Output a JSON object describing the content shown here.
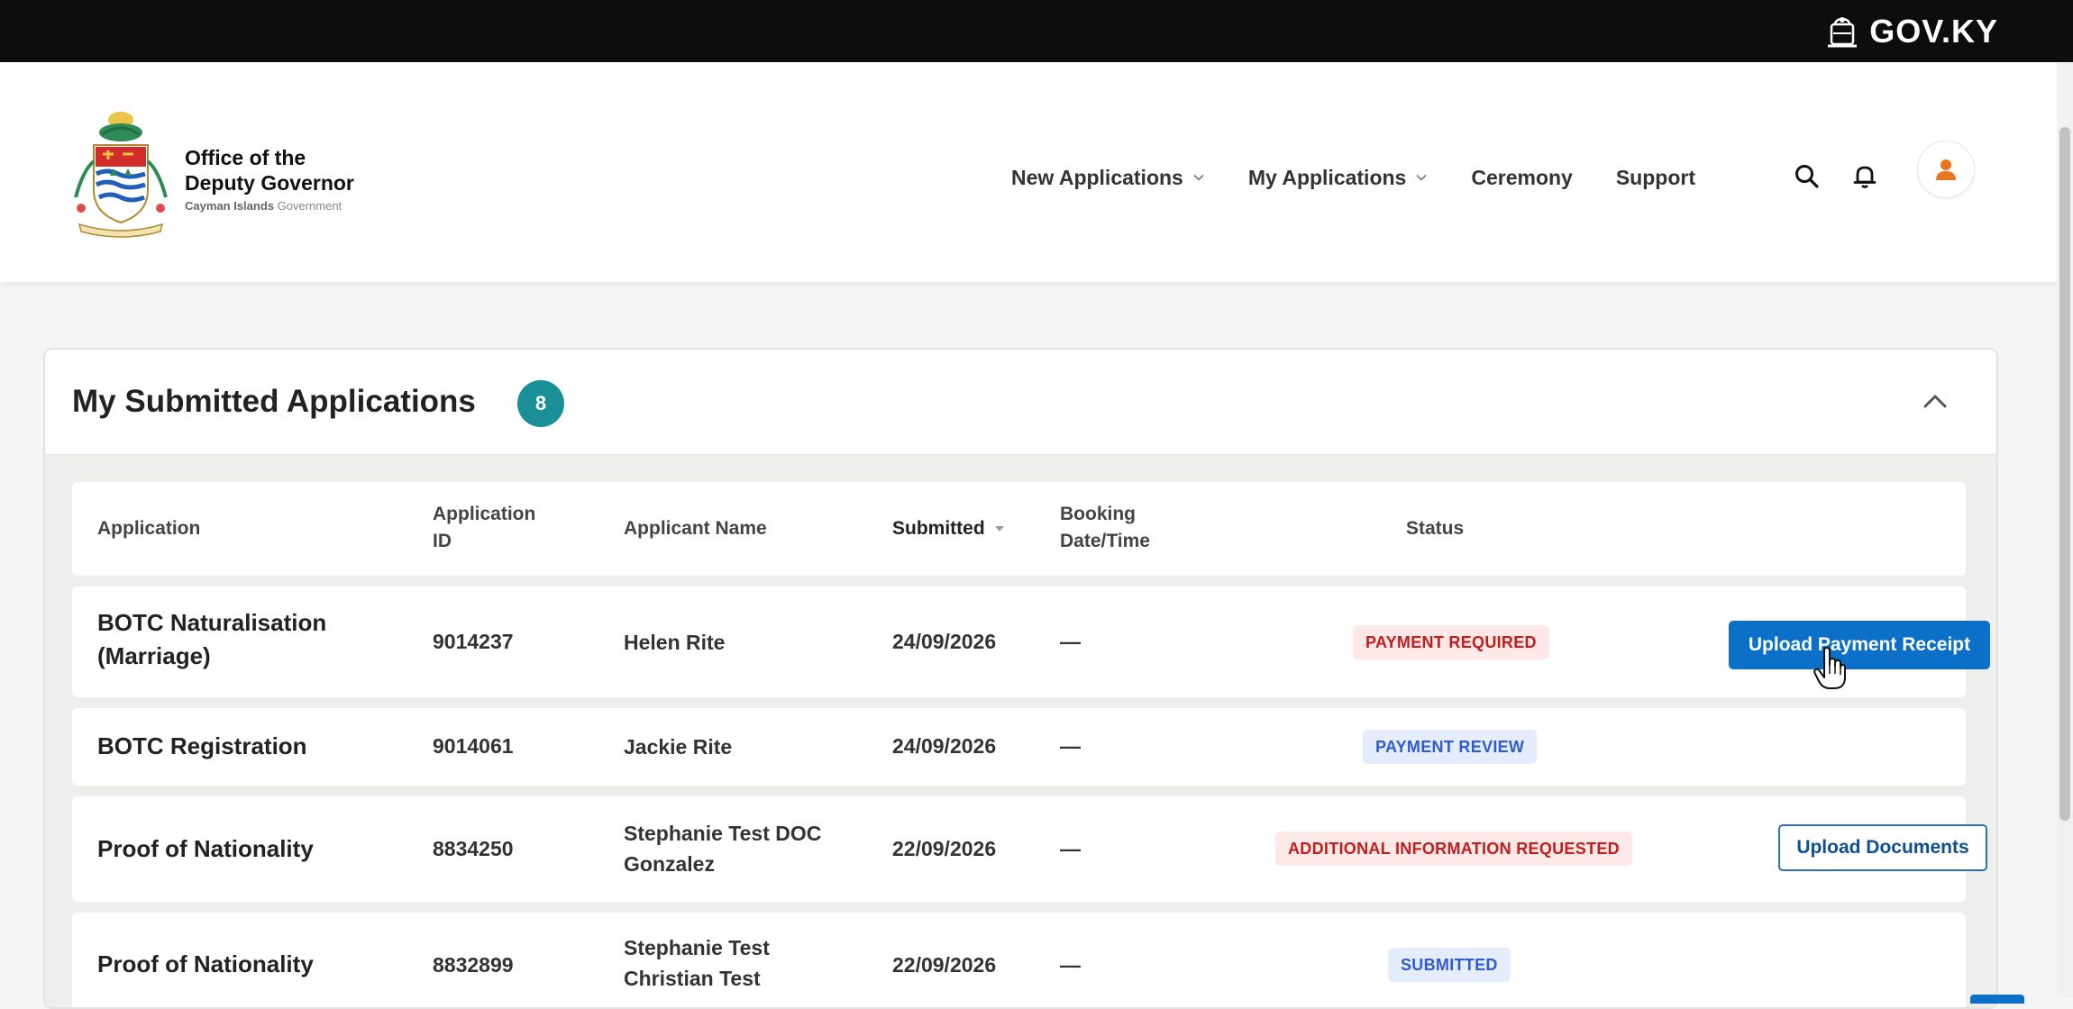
{
  "topbar": {
    "brand": "GOV.KY"
  },
  "header": {
    "org_line1": "Office of the",
    "org_line2": "Deputy Governor",
    "org_line3_bold": "Cayman Islands",
    "org_line3_rest": "Government",
    "nav": [
      {
        "label": "New Applications",
        "has_dropdown": true
      },
      {
        "label": "My Applications",
        "has_dropdown": true
      },
      {
        "label": "Ceremony",
        "has_dropdown": false
      },
      {
        "label": "Support",
        "has_dropdown": false
      }
    ],
    "icons": [
      "search-icon",
      "bell-icon",
      "user-icon"
    ]
  },
  "panel": {
    "title": "My Submitted Applications",
    "count": "8",
    "collapse_icon": "chevron-up-icon",
    "columns": {
      "application": "Application",
      "app_id_1": "Application",
      "app_id_2": "ID",
      "applicant": "Applicant Name",
      "submitted": "Submitted",
      "booking_1": "Booking",
      "booking_2": "Date/Time",
      "status": "Status"
    },
    "rows": [
      {
        "app_1": "BOTC Naturalisation",
        "app_2": "(Marriage)",
        "id": "9014237",
        "name_1": "Helen Rite",
        "name_2": "",
        "submitted": "24/09/2026",
        "booking": "—",
        "status": "PAYMENT REQUIRED",
        "action": "Upload Payment Receipt"
      },
      {
        "app_1": "BOTC Registration",
        "app_2": "",
        "id": "9014061",
        "name_1": "Jackie Rite",
        "name_2": "",
        "submitted": "24/09/2026",
        "booking": "—",
        "status": "PAYMENT REVIEW",
        "action": ""
      },
      {
        "app_1": "Proof of Nationality",
        "app_2": "",
        "id": "8834250",
        "name_1": "Stephanie Test DOC",
        "name_2": "Gonzalez",
        "submitted": "22/09/2026",
        "booking": "—",
        "status": "ADDITIONAL INFORMATION REQUESTED",
        "action": "Upload Documents"
      },
      {
        "app_1": "Proof of Nationality",
        "app_2": "",
        "id": "8832899",
        "name_1": "Stephanie Test",
        "name_2": "Christian Test",
        "submitted": "22/09/2026",
        "booking": "—",
        "status": "SUBMITTED",
        "action": ""
      }
    ]
  },
  "colors": {
    "accent": "#0d70c8",
    "badge": "#1b8f96",
    "status_red_text": "#c21d1d",
    "status_red_bg": "#fde8e8",
    "status_blue_text": "#2f5bd2",
    "status_blue_bg": "#e5edfc"
  }
}
